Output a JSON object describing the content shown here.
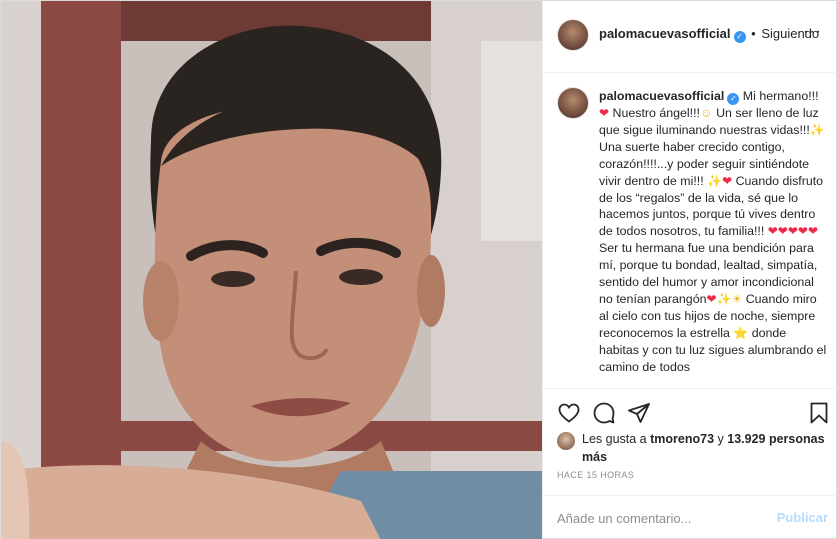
{
  "header": {
    "username": "palomacuevasofficial",
    "separator": "•",
    "follow_state": "Siguiendo",
    "more_icon": "ellipsis-icon"
  },
  "caption": {
    "username": "palomacuevasofficial",
    "segments": [
      "Mi hermano!!!",
      "Nuestro ángel!!!",
      "Un ser lleno de luz que sigue iluminando nuestras vidas!!!",
      "Una suerte haber crecido contigo, corazón!!!!...y poder seguir sintiéndote vivir dentro de mi!!!",
      "Cuando disfruto de los “regalos” de la vida, sé que lo hacemos juntos, porque tú vives dentro de todos nosotros, tu familia!!!",
      "Ser tu hermana fue una bendición para mí, porque tu bondad, lealtad, simpatía, sentido del humor y amor incondicional no tenían parangón",
      "Cuando miro al cielo con tus hijos de noche, siempre reconocemos la estrella",
      "donde habitas y con tu luz sigues alumbrando el camino de todos"
    ]
  },
  "actions": {
    "like_icon": "heart-icon",
    "comment_icon": "comment-icon",
    "share_icon": "paper-plane-icon",
    "save_icon": "bookmark-icon"
  },
  "likes": {
    "prefix": "Les gusta a",
    "user": "tmoreno73",
    "connector": "y",
    "count": "13.929 personas más"
  },
  "timestamp": "Hace 15 horas",
  "comment": {
    "placeholder": "Añade un comentario...",
    "publish_label": "Publicar"
  },
  "colors": {
    "accent_blue": "#3897f0",
    "publish_disabled": "#b3dbff",
    "heart_red": "#ed2a48",
    "muted_text": "#8e8e8e"
  }
}
